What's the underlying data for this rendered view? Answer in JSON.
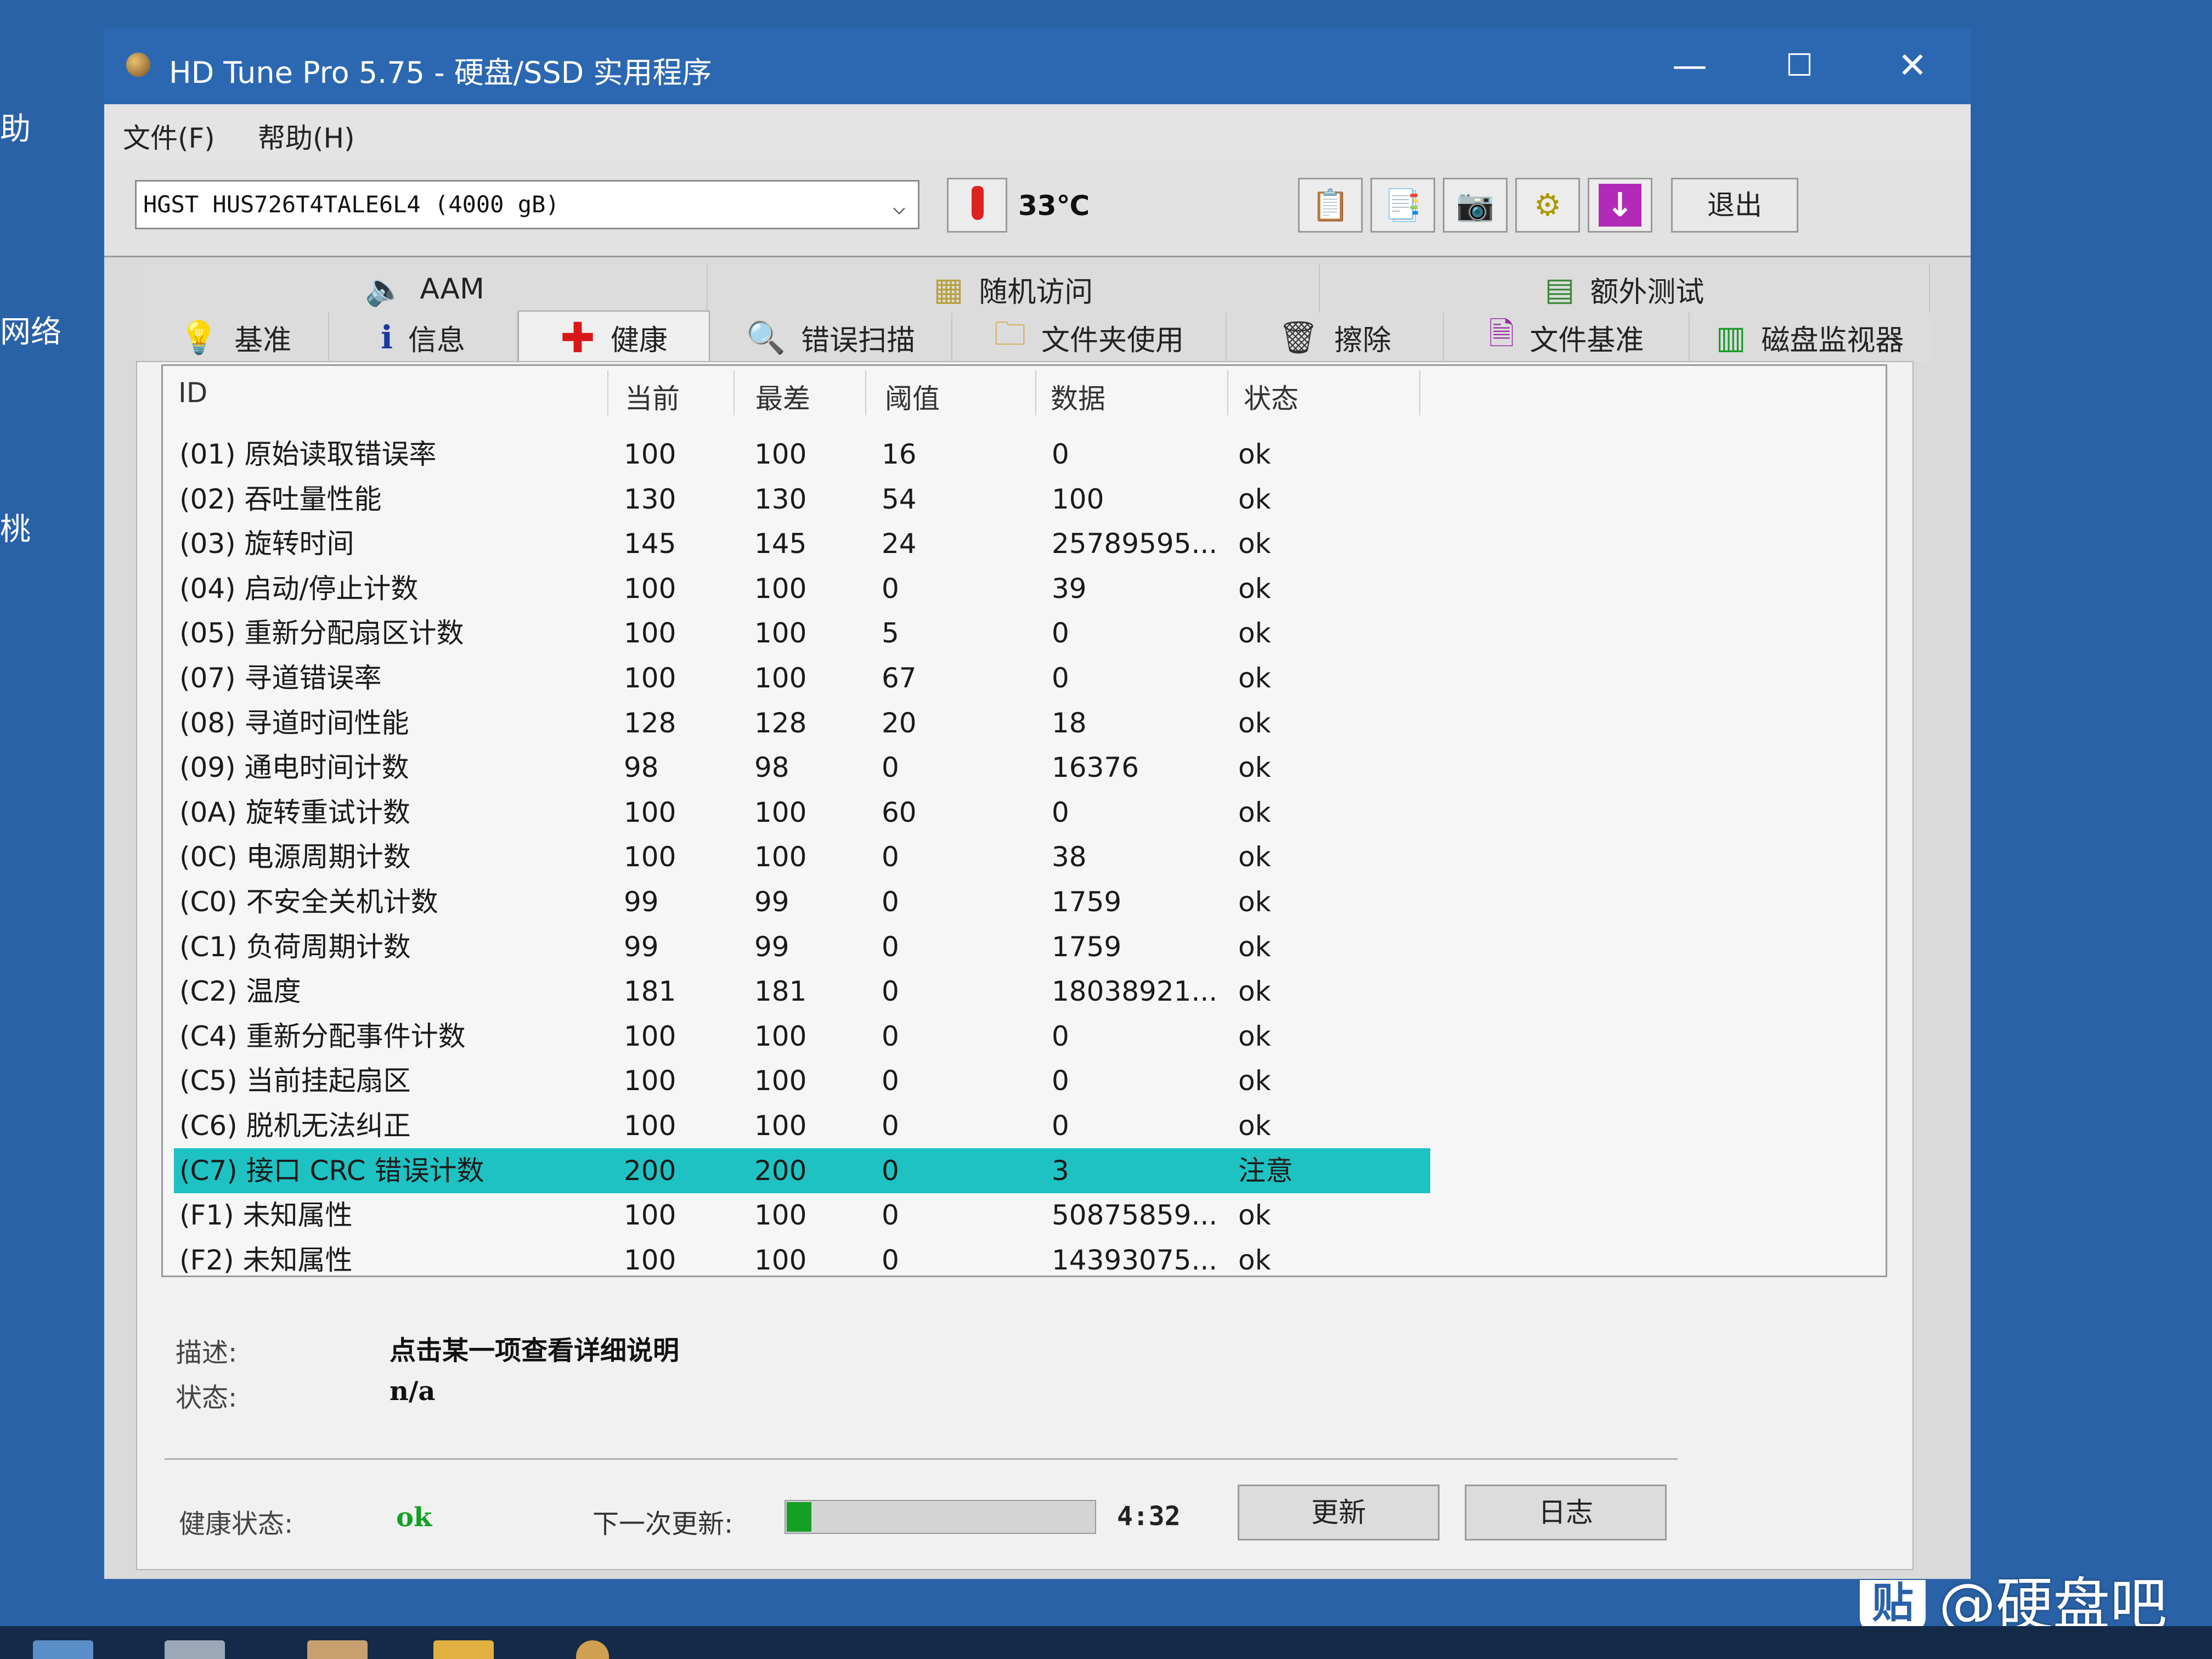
{
  "desktop": {
    "labels": [
      "助",
      "网络",
      "桃"
    ],
    "watermark_icon": "贴",
    "watermark": "@硬盘吧"
  },
  "window": {
    "title": "HD Tune Pro 5.75 - 硬盘/SSD 实用程序",
    "minimize": "—",
    "maximize": "☐",
    "close": "✕"
  },
  "menu": [
    "文件(F)",
    "帮助(H)"
  ],
  "toolbar": {
    "drive": "HGST HUS726T4TALE6L4 (4000 gB)",
    "temperature": "33℃",
    "exit_label": "退出",
    "icons": [
      "copy-icon",
      "copy-all-icon",
      "screenshot-icon",
      "options-icon",
      "download-icon"
    ]
  },
  "tabs_top": [
    "AAM",
    "随机访问",
    "额外测试"
  ],
  "tabs_bottom": [
    "基准",
    "信息",
    "健康",
    "错误扫描",
    "文件夹使用",
    "擦除",
    "文件基准",
    "磁盘监视器"
  ],
  "active_tab": "健康",
  "smart": {
    "columns": [
      "ID",
      "当前",
      "最差",
      "阈值",
      "数据",
      "状态"
    ],
    "rows": [
      [
        "(01) 原始读取错误率",
        "100",
        "100",
        "16",
        "0",
        "ok"
      ],
      [
        "(02) 吞吐量性能",
        "130",
        "130",
        "54",
        "100",
        "ok"
      ],
      [
        "(03) 旋转时间",
        "145",
        "145",
        "24",
        "25789595...",
        "ok"
      ],
      [
        "(04) 启动/停止计数",
        "100",
        "100",
        "0",
        "39",
        "ok"
      ],
      [
        "(05) 重新分配扇区计数",
        "100",
        "100",
        "5",
        "0",
        "ok"
      ],
      [
        "(07) 寻道错误率",
        "100",
        "100",
        "67",
        "0",
        "ok"
      ],
      [
        "(08) 寻道时间性能",
        "128",
        "128",
        "20",
        "18",
        "ok"
      ],
      [
        "(09) 通电时间计数",
        "98",
        "98",
        "0",
        "16376",
        "ok"
      ],
      [
        "(0A) 旋转重试计数",
        "100",
        "100",
        "60",
        "0",
        "ok"
      ],
      [
        "(0C) 电源周期计数",
        "100",
        "100",
        "0",
        "38",
        "ok"
      ],
      [
        "(C0) 不安全关机计数",
        "99",
        "99",
        "0",
        "1759",
        "ok"
      ],
      [
        "(C1) 负荷周期计数",
        "99",
        "99",
        "0",
        "1759",
        "ok"
      ],
      [
        "(C2) 温度",
        "181",
        "181",
        "0",
        "18038921...",
        "ok"
      ],
      [
        "(C4) 重新分配事件计数",
        "100",
        "100",
        "0",
        "0",
        "ok"
      ],
      [
        "(C5) 当前挂起扇区",
        "100",
        "100",
        "0",
        "0",
        "ok"
      ],
      [
        "(C6) 脱机无法纠正",
        "100",
        "100",
        "0",
        "0",
        "ok"
      ],
      [
        "(C7) 接口 CRC 错误计数",
        "200",
        "200",
        "0",
        "3",
        "注意"
      ],
      [
        "(F1) 未知属性",
        "100",
        "100",
        "0",
        "50875859...",
        "ok"
      ],
      [
        "(F2) 未知属性",
        "100",
        "100",
        "0",
        "14393075...",
        "ok"
      ]
    ],
    "selected_row": 16
  },
  "details": {
    "desc_label": "描述:",
    "desc_value": "点击某一项查看详细说明",
    "status_label": "状态:",
    "status_value": "n/a"
  },
  "footer": {
    "health_label": "健康状态:",
    "health_value": "ok",
    "next_update_label": "下一次更新:",
    "next_update_progress": 0.08,
    "countdown": "4:32",
    "refresh_label": "更新",
    "log_label": "日志"
  },
  "colors": {
    "titlebar": "#2c68b2",
    "selected_row": "#1ec2c2",
    "health_ok": "#13a024"
  }
}
